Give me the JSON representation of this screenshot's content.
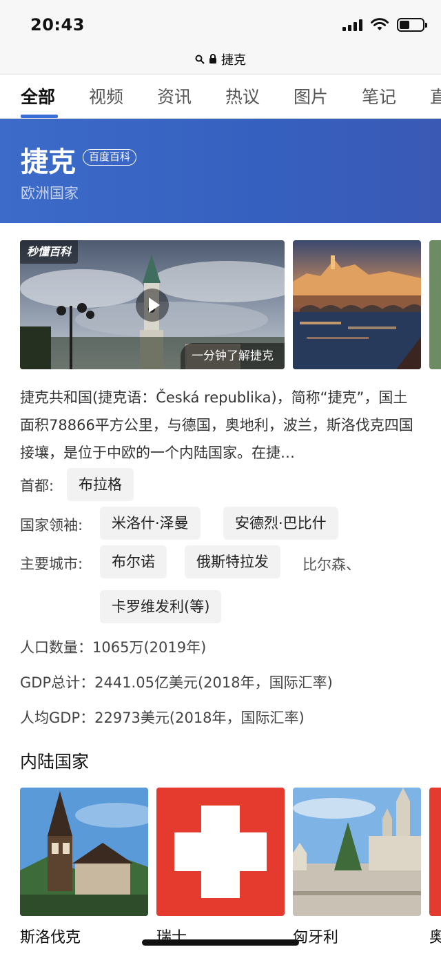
{
  "status_bar": {
    "time": "20:43"
  },
  "address_bar": {
    "text": "捷克"
  },
  "tabs": [
    {
      "label": "全部",
      "active": true
    },
    {
      "label": "视频"
    },
    {
      "label": "资讯"
    },
    {
      "label": "热议"
    },
    {
      "label": "图片"
    },
    {
      "label": "笔记"
    },
    {
      "label": "直"
    }
  ],
  "header": {
    "title": "捷克",
    "badge": "百度百科",
    "subtitle": "欧洲国家"
  },
  "media": {
    "video_logo": "秒懂百科",
    "video_caption": "一分钟了解捷克"
  },
  "description": "捷克共和国(捷克语：Česká republika)，简称“捷克”，国土面积78866平方公里，与德国，奥地利，波兰，斯洛伐克四国接壤，是位于中欧的一个内陆国家。在捷…",
  "info": {
    "capital": {
      "label": "首都:",
      "values": [
        "布拉格"
      ]
    },
    "leaders": {
      "label": "国家领袖:",
      "values": [
        "米洛什·泽曼",
        "安德烈·巴比什"
      ]
    },
    "cities": {
      "label": "主要城市:",
      "values": [
        "布尔诺",
        "俄斯特拉发"
      ],
      "extra_text": "比尔森、",
      "more": "卡罗维发利(等)"
    }
  },
  "stats": [
    {
      "text": "人口数量：1065万(2019年)"
    },
    {
      "text": "GDP总计：2441.05亿美元(2018年，国际汇率)"
    },
    {
      "text": "人均GDP：22973美元(2018年，国际汇率)"
    }
  ],
  "section": {
    "title": "内陆国家",
    "cards": [
      {
        "label": "斯洛伐克"
      },
      {
        "label": "瑞士"
      },
      {
        "label": "匈牙利"
      },
      {
        "label": "奥"
      }
    ]
  },
  "colors": {
    "accent": "#3a6fd8",
    "banner": "#3660bf",
    "chip_bg": "#f2f2f2",
    "swiss_red": "#e53b2f"
  }
}
